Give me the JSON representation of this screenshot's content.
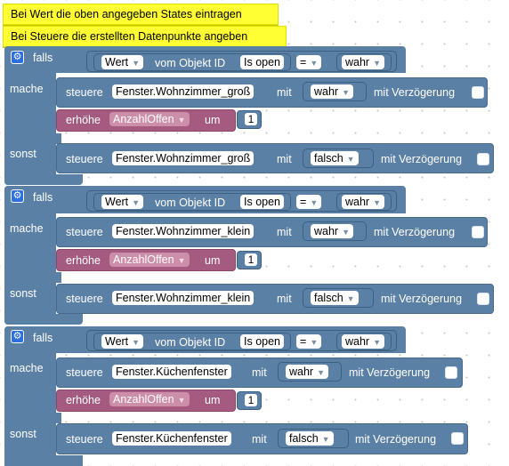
{
  "comments": [
    "Bei Wert die oben angegeben States eintragen",
    "Bei Steuere die erstellten Datenpunkte angeben"
  ],
  "labels": {
    "falls": "falls",
    "mache": "mache",
    "sonst": "sonst",
    "vom_objekt": "vom Objekt ID",
    "steuere": "steuere",
    "mit": "mit",
    "mit_verzoegerung": "mit Verzögerung",
    "erhoehe": "erhöhe",
    "um": "um"
  },
  "blocks": [
    {
      "condition": {
        "property": "Wert",
        "object": "Is open",
        "operator": "=",
        "value": "wahr"
      },
      "then_steuere": {
        "target": "Fenster.Wohnzimmer_groß",
        "value": "wahr"
      },
      "then_erhoehe": {
        "variable": "AnzahlOffen",
        "amount": "1"
      },
      "else_steuere": {
        "target": "Fenster.Wohnzimmer_groß",
        "value": "falsch"
      }
    },
    {
      "condition": {
        "property": "Wert",
        "object": "Is open",
        "operator": "=",
        "value": "wahr"
      },
      "then_steuere": {
        "target": "Fenster.Wohnzimmer_klein",
        "value": "wahr"
      },
      "then_erhoehe": {
        "variable": "AnzahlOffen",
        "amount": "1"
      },
      "else_steuere": {
        "target": "Fenster.Wohnzimmer_klein",
        "value": "falsch"
      }
    },
    {
      "condition": {
        "property": "Wert",
        "object": "Is open",
        "operator": "=",
        "value": "wahr"
      },
      "then_steuere": {
        "target": "Fenster.Küchenfenster",
        "value": "wahr"
      },
      "then_erhoehe": {
        "variable": "AnzahlOffen",
        "amount": "1"
      },
      "else_steuere": {
        "target": "Fenster.Küchenfenster",
        "value": "falsch"
      }
    }
  ],
  "icons": {
    "gear": "gear-icon",
    "dropdown": "dropdown-arrow-icon"
  },
  "colors": {
    "logic_block": "#5b80a5",
    "math_block": "#a55b80",
    "comment": "#ffff33",
    "gear": "#2b6fe0"
  }
}
